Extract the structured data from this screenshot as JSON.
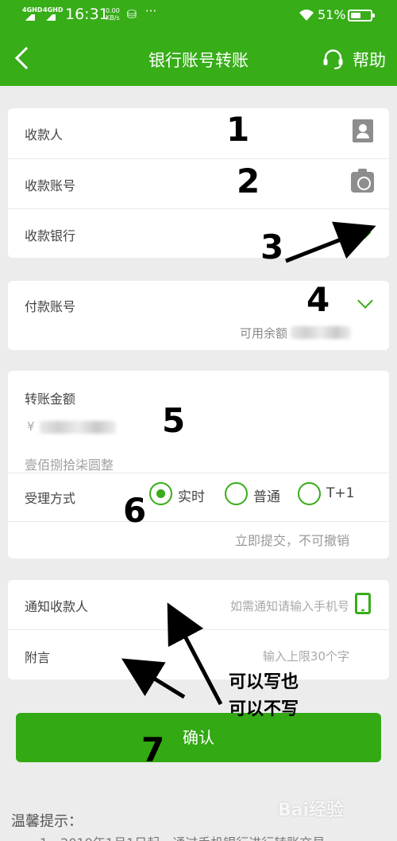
{
  "status_bar": {
    "sig1": "4GHD",
    "sig2": "4GHD",
    "time": "16:31",
    "speed_value": "0.00",
    "speed_unit": "KB/s",
    "more": "···",
    "battery_pct": "51%",
    "battery_level": 0.51
  },
  "header": {
    "title": "银行账号转账",
    "help_label": "帮助"
  },
  "payee_card": {
    "payee_label": "收款人",
    "account_label": "收款账号",
    "bank_label": "收款银行"
  },
  "payer_card": {
    "account_label": "付款账号",
    "balance_label": "可用余额"
  },
  "amount_card": {
    "amount_label": "转账金额",
    "amount_prefix": "¥",
    "amount_words": "壹佰捌拾柒圆整",
    "method_label": "受理方式",
    "options": [
      "实时",
      "普通",
      "T+1"
    ],
    "selected_option": "实时",
    "method_note": "立即提交，不可撤销"
  },
  "notify_card": {
    "notify_label": "通知收款人",
    "notify_placeholder": "如需通知请输入手机号",
    "memo_label": "附言",
    "memo_placeholder": "输入上限30个字"
  },
  "confirm_label": "确认",
  "tips": {
    "title": "温馨提示：",
    "line1": "1、2019年1月1日起，通过手机银行进行转账交易"
  },
  "annotations": {
    "n1": "1",
    "n2": "2",
    "n3": "3",
    "n4": "4",
    "n5": "5",
    "n6": "6",
    "n7": "7",
    "note_line1": "可以写也",
    "note_line2": "可以不写"
  },
  "watermark": "Bai经验",
  "colors": {
    "brand_green": "#37ad18",
    "background": "#ececec"
  }
}
